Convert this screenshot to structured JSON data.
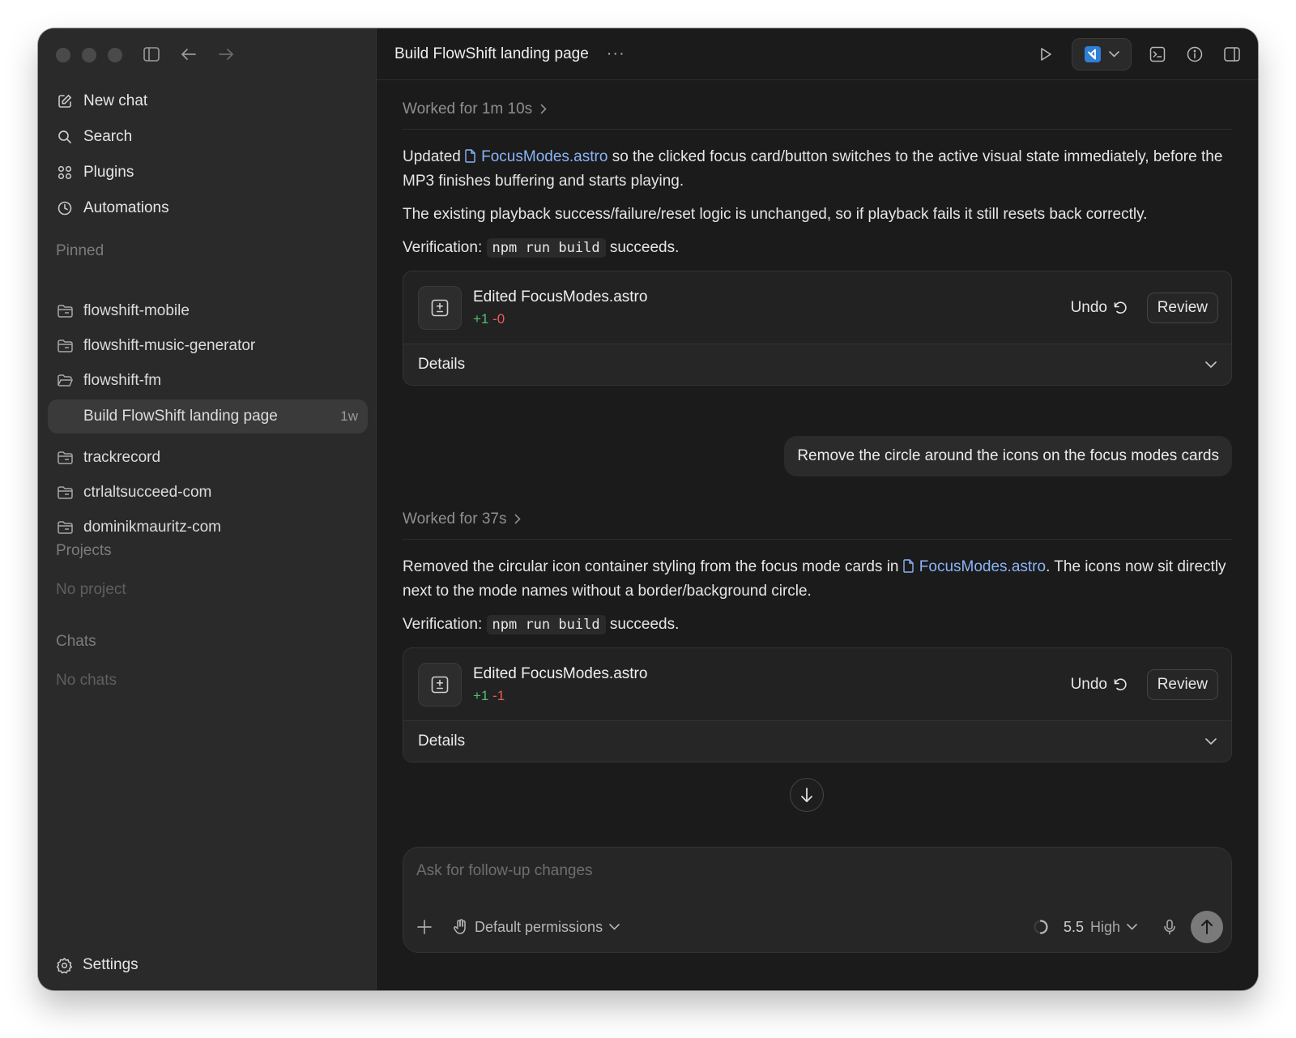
{
  "sidebar": {
    "nav": [
      {
        "label": "New chat",
        "icon": "compose-icon"
      },
      {
        "label": "Search",
        "icon": "search-icon"
      },
      {
        "label": "Plugins",
        "icon": "plugins-icon"
      },
      {
        "label": "Automations",
        "icon": "clock-icon"
      }
    ],
    "pinned_label": "Pinned",
    "pinned": [
      {
        "label": "flowshift-mobile"
      },
      {
        "label": "flowshift-music-generator"
      },
      {
        "label": "flowshift-fm"
      },
      {
        "label": "Build FlowShift landing page",
        "age": "1w",
        "active": true
      },
      {
        "label": "trackrecord"
      },
      {
        "label": "ctrlaltsucceed-com"
      },
      {
        "label": "dominikmauritz-com"
      }
    ],
    "projects_label": "Projects",
    "projects_empty": "No project",
    "chats_label": "Chats",
    "chats_empty": "No chats",
    "settings_label": "Settings"
  },
  "topbar": {
    "title": "Build FlowShift landing page",
    "more": "···"
  },
  "thread": {
    "block1": {
      "worked": "Worked for 1m 10s",
      "p1_pre": "Updated ",
      "p1_file": "FocusModes.astro",
      "p1_post": " so the clicked focus card/button switches to the active visual state immediately, before the MP3 finishes buffering and starts playing.",
      "p2": "The existing playback success/failure/reset logic is unchanged, so if playback fails it still resets back correctly.",
      "verif_pre": "Verification: ",
      "verif_code": "npm run build",
      "verif_post": " succeeds.",
      "card": {
        "title": "Edited FocusModes.astro",
        "plus": "+1",
        "minus": "-0",
        "undo": "Undo",
        "review": "Review",
        "details": "Details"
      }
    },
    "user_message": "Remove the circle around the icons on the focus modes cards",
    "block2": {
      "worked": "Worked for 37s",
      "p1_pre": "Removed the circular icon container styling from the focus mode cards in ",
      "p1_file": "FocusModes.astro",
      "p1_post": ". The icons now sit directly next to the mode names without a border/background circle.",
      "verif_pre": "Verification: ",
      "verif_code": "npm run build",
      "verif_post": " succeeds.",
      "card": {
        "title": "Edited FocusModes.astro",
        "plus": "+1",
        "minus": "-1",
        "undo": "Undo",
        "review": "Review",
        "details": "Details"
      }
    }
  },
  "composer": {
    "placeholder": "Ask for follow-up changes",
    "permissions": "Default permissions",
    "model": "5.5",
    "level": "High"
  },
  "colors": {
    "link": "#8ab4f8",
    "plus": "#4fc06a",
    "minus": "#ef5a5a"
  }
}
